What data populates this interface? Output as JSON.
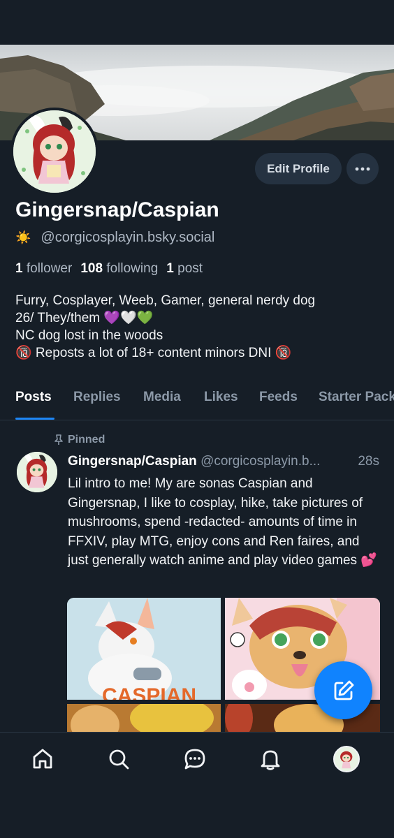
{
  "profile": {
    "display_name": "Gingersnap/Caspian",
    "handle_emoji": "☀️",
    "handle": "@corgicosplayin.bsky.social",
    "edit_button": "Edit Profile",
    "stats": {
      "followers_count": "1",
      "followers_label": "follower",
      "following_count": "108",
      "following_label": "following",
      "posts_count": "1",
      "posts_label": "post"
    },
    "bio": [
      "Furry, Cosplayer, Weeb, Gamer,  general nerdy dog",
      "26/ They/them 💜🤍💚",
      "NC dog lost in the woods",
      "🔞 Reposts a lot of 18+ content minors DNI 🔞"
    ]
  },
  "tabs": [
    "Posts",
    "Replies",
    "Media",
    "Likes",
    "Feeds",
    "Starter Packs"
  ],
  "active_tab": "Posts",
  "post": {
    "pinned_label": "Pinned",
    "author": "Gingersnap/Caspian",
    "handle": "@corgicosplayin.b...",
    "time": "28s",
    "text": "Lil intro to me! My are sonas Caspian and Gingersnap, I like to cosplay, hike, take pictures of mushrooms, spend -redacted- amounts of time in FFXIV, play MTG, enjoy cons and Ren faires, and just generally watch anime and play video games 💕"
  },
  "icons": {
    "more": "more-horizontal-icon",
    "pin": "pin-icon",
    "compose": "compose-icon",
    "nav": [
      "home-icon",
      "search-icon",
      "chat-icon",
      "bell-icon",
      "profile-avatar"
    ]
  },
  "colors": {
    "background": "#161e27",
    "accent": "#1083fe",
    "button_bg": "#253241",
    "muted_text": "#8c99a8"
  }
}
